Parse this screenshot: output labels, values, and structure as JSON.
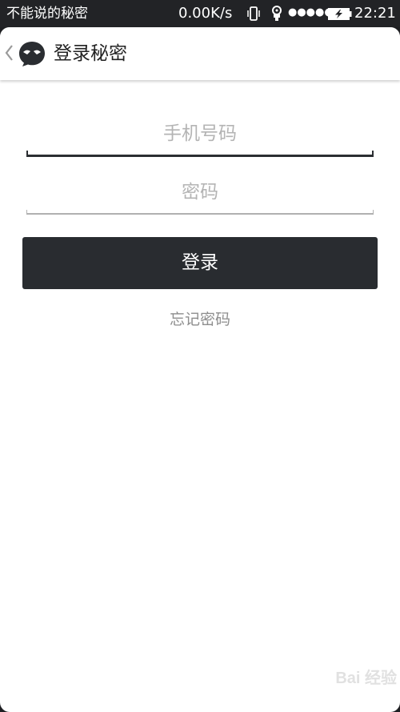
{
  "status_bar": {
    "app_name": "不能说的秘密",
    "net_speed": "0.00K/s",
    "signal": "●●●●●",
    "time": "22:21"
  },
  "header": {
    "title": "登录秘密"
  },
  "form": {
    "phone_placeholder": "手机号码",
    "password_placeholder": "密码",
    "login_label": "登录",
    "forgot_label": "忘记密码"
  },
  "watermark": {
    "text": "Bai 经验"
  },
  "icons": [
    "vibrate-icon",
    "usb-icon",
    "battery-charging-icon",
    "back-chevron-icon",
    "app-logo-icon"
  ],
  "colors": {
    "button": "#292c30",
    "placeholder": "#b4b4b4",
    "link": "#8e8e8e"
  }
}
